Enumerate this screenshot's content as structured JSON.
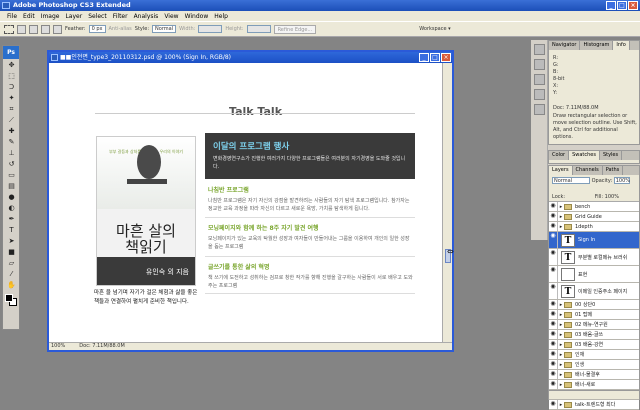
{
  "app": {
    "title": "Adobe Photoshop CS3 Extended"
  },
  "menu": [
    "File",
    "Edit",
    "Image",
    "Layer",
    "Select",
    "Filter",
    "Analysis",
    "View",
    "Window",
    "Help"
  ],
  "options": {
    "feather_label": "Feather:",
    "feather_value": "0 px",
    "antialias_label": "Anti-alias",
    "style_label": "Style:",
    "style_value": "Normal",
    "width_label": "Width:",
    "height_label": "Height:",
    "refine_edge": "Refine Edge...",
    "workspace": "Workspace ▾"
  },
  "toolbox": {
    "logo": "Ps"
  },
  "document": {
    "title": "■■인전면_type3_20110312.psd @ 100% (Sign In, RGB/8)",
    "zoom": "100%",
    "doc_size": "Doc: 7.11M/88.0M",
    "section_title": "Talk Talk",
    "book": {
      "subtitle": "부부 갈등과 상처를 안고 사는 우리의 이야기",
      "title_line1": "마흔 살의",
      "title_line2": "책읽기",
      "bottom": "유인숙 외 지음"
    },
    "book_desc": "마흔 을 넘기며 자기가 걸은 체험과 삶을 좋은 책들과 연결하여 펼치게 준비한 책입니다.",
    "program": {
      "title": "이달의 프로그램 행사",
      "desc": "변화경영연구소가 진행한 여러가지 다양한 프로그램들은 여러분의 자기경영을 도와줄 것입니다."
    },
    "items": [
      {
        "heading": "나침반 프로그램",
        "text": "나침반 프로그램은 자기 자신의 강점을 발견하려는 사람들의 자기 탐색 프로그램입니다. 참가자는 정교한 교육 과정을 따라 자신의 다르고 새로운 욕망, 가치를 탐색하게 됩니다."
      },
      {
        "heading": "모닝페이지와 함께 하는 8주 자기 발견 여행",
        "text": "모닝페이지가 있는 교육의 탁월한 성장과 여자들이 만들어내는 그룹을 이용하여 개인의 일한 성장을 돕는 프로그램"
      },
      {
        "heading": "글쓰기를 통한 삶의 혁명",
        "text": "책 쓰기에 도전하고 성취하는 검프로 창한 작가를 향해 진행을 갈구하는 사람들이 서로 배우고 도와주는 프로그램"
      }
    ]
  },
  "panels": {
    "nav_tabs": [
      "Navigator",
      "Histogram",
      "Info"
    ],
    "info_lines": [
      "R:",
      "G:",
      "B:",
      "8-bit",
      "X:",
      "Y:"
    ],
    "info_doc": "Doc: 7.11M/88.0M",
    "info_note": "Draw rectangular selection or move selection outline. Use Shift, Alt, and Ctrl for additional options.",
    "color_tabs": [
      "Color",
      "Swatches",
      "Styles"
    ],
    "layer_tabs": [
      "Layers",
      "Channels",
      "Paths"
    ],
    "blend_mode": "Normal",
    "opacity_label": "Opacity:",
    "opacity_value": "100%",
    "lock_label": "Lock:",
    "fill_label": "Fill:",
    "fill_value": "100%",
    "layers": [
      {
        "name": "bench",
        "kind": "folder"
      },
      {
        "name": "Grid Guide",
        "kind": "folder"
      },
      {
        "name": "1depth",
        "kind": "folder"
      },
      {
        "name": "Sign In",
        "kind": "text",
        "selected": true
      },
      {
        "name": "부분별 로컬메뉴 브러쉬",
        "kind": "text"
      },
      {
        "name": "표현",
        "kind": "image"
      },
      {
        "name": "이메일 인증주소 페이지",
        "kind": "text"
      },
      {
        "name": "00 상단0",
        "kind": "folder"
      },
      {
        "name": "01 탑메",
        "kind": "folder"
      },
      {
        "name": "02 메뉴-연구원",
        "kind": "folder"
      },
      {
        "name": "03 배움-글쓰",
        "kind": "folder"
      },
      {
        "name": "03 배움-강연",
        "kind": "folder"
      },
      {
        "name": "인재",
        "kind": "folder"
      },
      {
        "name": "인생",
        "kind": "folder"
      },
      {
        "name": "배너-물결후",
        "kind": "folder"
      },
      {
        "name": "배너-새로",
        "kind": "folder"
      },
      {
        "name": "talk-구역나",
        "kind": "folder"
      },
      {
        "name": "talk-트렌드형 최다",
        "kind": "folder"
      }
    ]
  }
}
